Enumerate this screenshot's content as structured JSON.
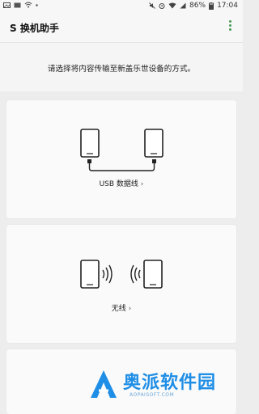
{
  "status_bar": {
    "battery_percent": "86%",
    "time": "17:04"
  },
  "app_bar": {
    "title": "S 换机助手",
    "menu_icon": "more-vert-icon"
  },
  "instruction": "请选择将内容传输至新盖乐世设备的方式。",
  "options": [
    {
      "label": "USB 数据线 ",
      "icon": "usb-transfer-icon",
      "chevron": "chevron-right-icon"
    },
    {
      "label": "无线 ",
      "icon": "wireless-transfer-icon",
      "chevron": "chevron-right-icon"
    }
  ],
  "watermark": {
    "text": "奥派软件园",
    "sub": "AOPAISOFT.COM"
  },
  "colors": {
    "accent_green": "#4a9a5a",
    "watermark_blue": "#1f8ee6"
  }
}
